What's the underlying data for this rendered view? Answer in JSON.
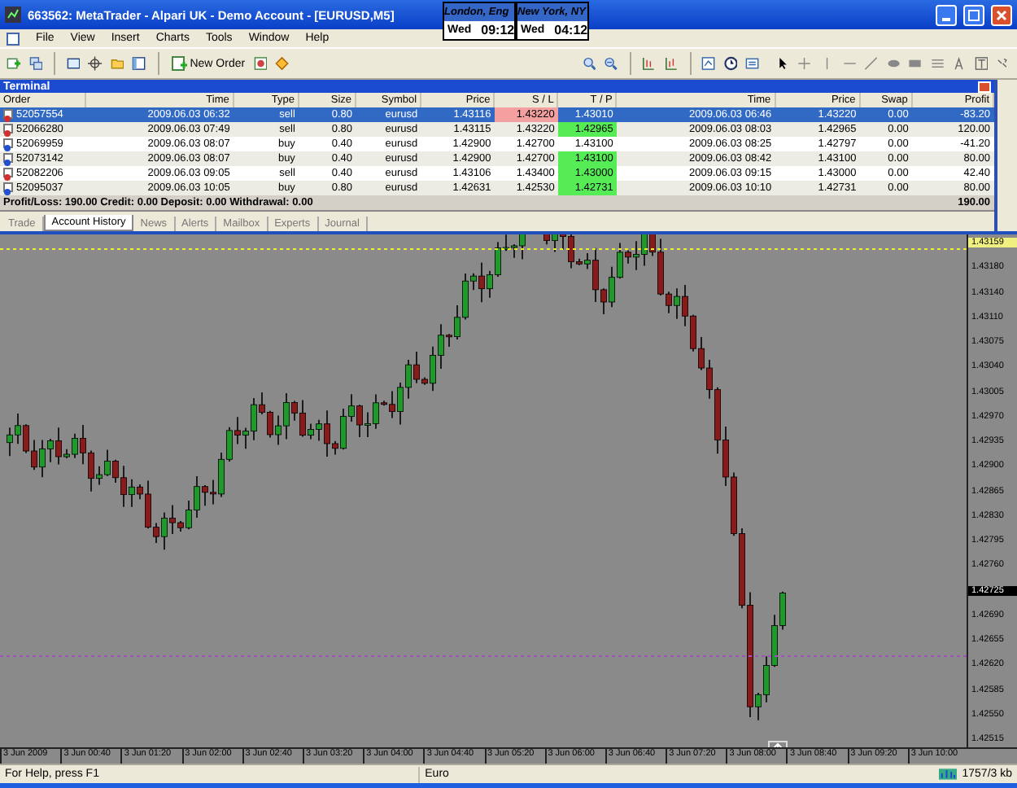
{
  "window": {
    "title": "663562: MetaTrader - Alpari UK - Demo Account - [EURUSD,M5]"
  },
  "clocks": [
    {
      "city": "London, Eng",
      "day": "Wed",
      "time": "09:12"
    },
    {
      "city": "New York, NY",
      "day": "Wed",
      "time": "04:12"
    }
  ],
  "menu": [
    "File",
    "View",
    "Insert",
    "Charts",
    "Tools",
    "Window",
    "Help"
  ],
  "toolbar": {
    "new_order": "New Order"
  },
  "terminal": {
    "title": "Terminal",
    "columns": [
      "Order",
      "Time",
      "Type",
      "Size",
      "Symbol",
      "Price",
      "S / L",
      "T / P",
      "Time",
      "Price",
      "Swap",
      "Profit"
    ],
    "rows": [
      {
        "kind": "sell",
        "selected": true,
        "sl_hit": true,
        "tp_hit": false,
        "cells": [
          "52057554",
          "2009.06.03 06:32",
          "sell",
          "0.80",
          "eurusd",
          "1.43116",
          "1.43220",
          "1.43010",
          "2009.06.03 06:46",
          "1.43220",
          "0.00",
          "-83.20"
        ]
      },
      {
        "kind": "sell",
        "selected": false,
        "sl_hit": false,
        "tp_hit": true,
        "cells": [
          "52066280",
          "2009.06.03 07:49",
          "sell",
          "0.80",
          "eurusd",
          "1.43115",
          "1.43220",
          "1.42965",
          "2009.06.03 08:03",
          "1.42965",
          "0.00",
          "120.00"
        ]
      },
      {
        "kind": "buy",
        "selected": false,
        "sl_hit": false,
        "tp_hit": false,
        "cells": [
          "52069959",
          "2009.06.03 08:07",
          "buy",
          "0.40",
          "eurusd",
          "1.42900",
          "1.42700",
          "1.43100",
          "2009.06.03 08:25",
          "1.42797",
          "0.00",
          "-41.20"
        ]
      },
      {
        "kind": "buy",
        "selected": false,
        "sl_hit": false,
        "tp_hit": true,
        "cells": [
          "52073142",
          "2009.06.03 08:07",
          "buy",
          "0.40",
          "eurusd",
          "1.42900",
          "1.42700",
          "1.43100",
          "2009.06.03 08:42",
          "1.43100",
          "0.00",
          "80.00"
        ]
      },
      {
        "kind": "sell",
        "selected": false,
        "sl_hit": false,
        "tp_hit": true,
        "cells": [
          "52082206",
          "2009.06.03 09:05",
          "sell",
          "0.40",
          "eurusd",
          "1.43106",
          "1.43400",
          "1.43000",
          "2009.06.03 09:15",
          "1.43000",
          "0.00",
          "42.40"
        ]
      },
      {
        "kind": "buy",
        "selected": false,
        "sl_hit": false,
        "tp_hit": true,
        "cells": [
          "52095037",
          "2009.06.03 10:05",
          "buy",
          "0.80",
          "eurusd",
          "1.42631",
          "1.42530",
          "1.42731",
          "2009.06.03 10:10",
          "1.42731",
          "0.00",
          "80.00"
        ]
      }
    ],
    "summary": "Profit/Loss: 190.00  Credit: 0.00  Deposit: 0.00  Withdrawal: 0.00",
    "total": "190.00",
    "tabs": [
      {
        "label": "Trade",
        "selected": false
      },
      {
        "label": "Account History",
        "selected": true
      },
      {
        "label": "News",
        "selected": false
      },
      {
        "label": "Alerts",
        "selected": false
      },
      {
        "label": "Mailbox",
        "selected": false
      },
      {
        "label": "Experts",
        "selected": false
      },
      {
        "label": "Journal",
        "selected": false
      }
    ]
  },
  "chart": {
    "bid_label": "1.43159",
    "price_labels": [
      {
        "text": "1.43180",
        "current": false
      },
      {
        "text": "1.43140",
        "current": false
      },
      {
        "text": "1.43110",
        "current": false
      },
      {
        "text": "1.43075",
        "current": false
      },
      {
        "text": "1.43040",
        "current": false
      },
      {
        "text": "1.43005",
        "current": false
      },
      {
        "text": "1.42970",
        "current": false
      },
      {
        "text": "1.42935",
        "current": false
      },
      {
        "text": "1.42900",
        "current": false
      },
      {
        "text": "1.42865",
        "current": false
      },
      {
        "text": "1.42830",
        "current": false
      },
      {
        "text": "1.42795",
        "current": false
      },
      {
        "text": "1.42760",
        "current": false
      },
      {
        "text": "1.42725",
        "current": true
      },
      {
        "text": "1.42690",
        "current": false
      },
      {
        "text": "1.42655",
        "current": false
      },
      {
        "text": "1.42620",
        "current": false
      },
      {
        "text": "1.42585",
        "current": false
      },
      {
        "text": "1.42550",
        "current": false
      },
      {
        "text": "1.42515",
        "current": false
      }
    ],
    "time_labels": [
      "3 Jun 2009",
      "3 Jun 00:40",
      "3 Jun 01:20",
      "3 Jun 02:00",
      "3 Jun 02:40",
      "3 Jun 03:20",
      "3 Jun 04:00",
      "3 Jun 04:40",
      "3 Jun 05:20",
      "3 Jun 06:00",
      "3 Jun 06:40",
      "3 Jun 07:20",
      "3 Jun 08:00",
      "3 Jun 08:40",
      "3 Jun 09:20",
      "3 Jun 10:00"
    ]
  },
  "status_bar": {
    "help": "For Help, press F1",
    "profile": "Euro",
    "traffic": "1757/3 kb"
  }
}
